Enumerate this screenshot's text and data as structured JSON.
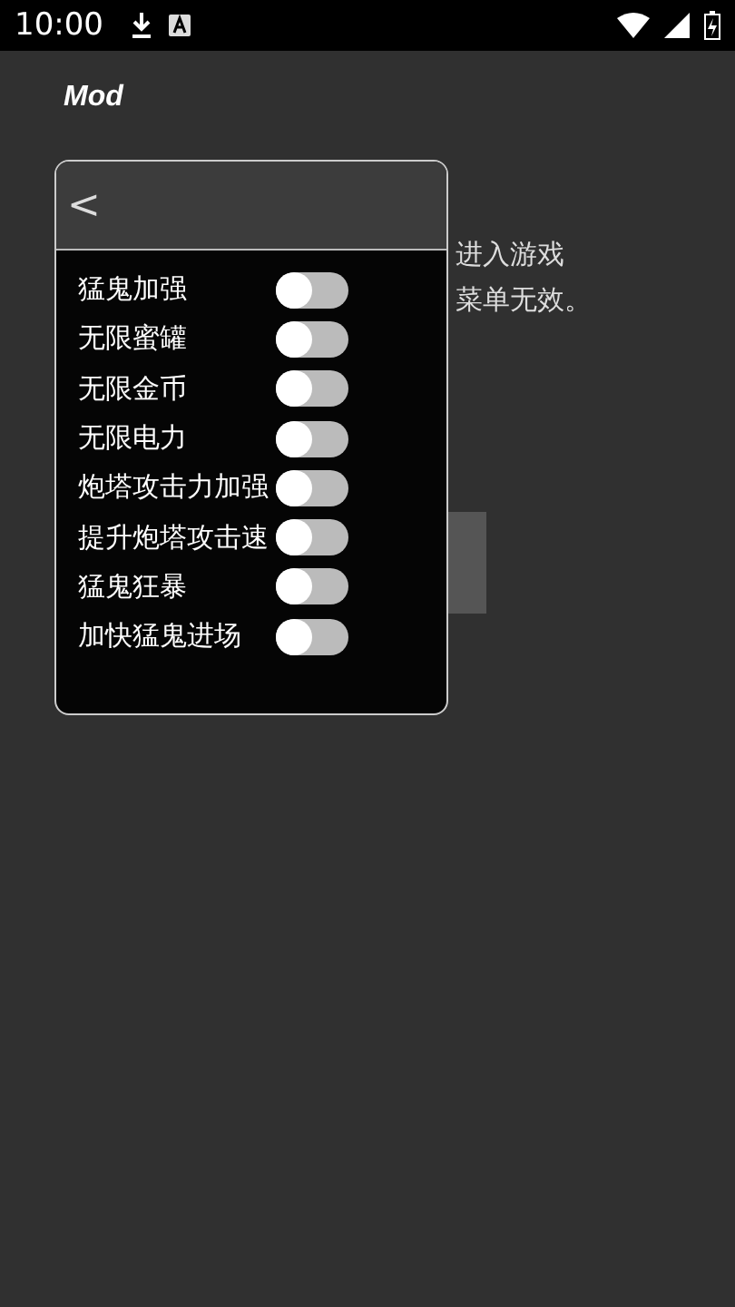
{
  "status_bar": {
    "time": "10:00"
  },
  "app_bar": {
    "title": "Mod"
  },
  "notice": {
    "lines": [
      "进入游戏",
      "菜单无效。"
    ]
  },
  "menu": {
    "back": "<",
    "items": [
      {
        "label": "猛鬼加强",
        "on": false
      },
      {
        "label": "无限蜜罐",
        "on": false
      },
      {
        "label": "无限金币",
        "on": false
      },
      {
        "label": "无限电力",
        "on": false
      },
      {
        "label": "炮塔攻击力加强",
        "on": false
      },
      {
        "label": "提升炮塔攻击速",
        "on": false
      },
      {
        "label": "猛鬼狂暴",
        "on": false
      },
      {
        "label": "加快猛鬼进场",
        "on": false
      }
    ]
  }
}
